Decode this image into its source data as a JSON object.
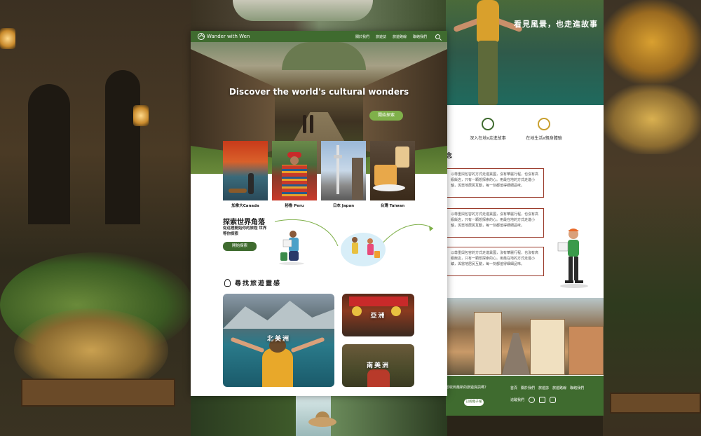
{
  "nav": {
    "brand": "Wander with Wen",
    "links": [
      "關於我們",
      "旅遊誌",
      "旅遊路線",
      "聯絡我們"
    ]
  },
  "hero": {
    "title": "Discover the world's cultural wonders",
    "button": "開始探索"
  },
  "destinations": [
    {
      "label": "加拿大Canada"
    },
    {
      "label": "秘魯 Peru"
    },
    {
      "label": "日本 Japan"
    },
    {
      "label": "台灣 Taiwan"
    }
  ],
  "explore": {
    "title": "探索世界角落",
    "subtitle": "從這裡開始你的旅程 世界等你探索",
    "button": "開始探索"
  },
  "inspiration": {
    "title": "尋找旅遊靈感",
    "regions": [
      "北美洲",
      "亞洲",
      "南美洲"
    ]
  },
  "right_page": {
    "hero_title": "看見風景，也走進故事",
    "features": [
      "深入在地x走進故事",
      "在地生活x親身體驗"
    ],
    "section_heading_fragment": "念",
    "box_text": [
      "以尊重與包容的方式走進異國，沒有華麗行程，也沒有高級飯店，只有一顆想探索的心。用最在地的方式走進小鎮，與當地居民互動，每一刻都值得細細品味。",
      "以尊重與包容的方式走進異國，沒有華麗行程，也沒有高級飯店，只有一顆想探索的心。用最在地的方式走進小鎮，與當地居民互動，每一刻都值得細細品味。",
      "以尊重與包容的方式走進異國，沒有華麗行程，也沒有高級飯店，只有一顆想探索的心。用最在地的方式走進小鎮，與當地居民互動，每一刻都值得細細品味。"
    ],
    "footer": {
      "subscribe_text": "想收到最新的旅遊資訊嗎？",
      "subscribe_button": "訂閱電子報",
      "links": [
        "首頁",
        "關於我們",
        "旅遊誌",
        "旅遊路線",
        "聯絡我們"
      ],
      "follow_label": "追蹤我們"
    }
  },
  "colors": {
    "brand_green": "#3f6b2f",
    "accent_green": "#7fb04a",
    "box_border": "#9a3a2a"
  }
}
